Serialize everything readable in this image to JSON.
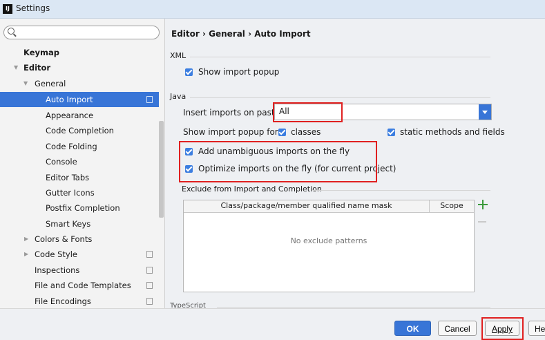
{
  "window": {
    "title": "Settings",
    "app_icon_text": "IJ"
  },
  "search": {
    "value": "",
    "placeholder": ""
  },
  "sidebar": {
    "items": [
      {
        "label": "Keymap"
      },
      {
        "label": "Editor"
      },
      {
        "label": "General"
      },
      {
        "label": "Auto Import"
      },
      {
        "label": "Appearance"
      },
      {
        "label": "Code Completion"
      },
      {
        "label": "Code Folding"
      },
      {
        "label": "Console"
      },
      {
        "label": "Editor Tabs"
      },
      {
        "label": "Gutter Icons"
      },
      {
        "label": "Postfix Completion"
      },
      {
        "label": "Smart Keys"
      },
      {
        "label": "Colors & Fonts"
      },
      {
        "label": "Code Style"
      },
      {
        "label": "Inspections"
      },
      {
        "label": "File and Code Templates"
      },
      {
        "label": "File Encodings"
      }
    ]
  },
  "main": {
    "breadcrumb": "Editor › General › Auto Import",
    "xml": {
      "section_title": "XML",
      "show_import_popup": {
        "label": "Show import popup",
        "checked": true
      }
    },
    "java": {
      "section_title": "Java",
      "insert_imports_label": "Insert imports on paste:",
      "insert_imports_value": "All",
      "show_popup_for_label": "Show import popup for:",
      "classes_label": "classes",
      "static_label": "static methods and fields",
      "add_unambiguous_label": "Add unambiguous imports on the fly",
      "optimize_label": "Optimize imports on the fly (for current project)"
    },
    "exclude": {
      "section_title": "Exclude from Import and Completion",
      "columns": [
        "Class/package/member qualified name mask",
        "Scope"
      ],
      "empty_text": "No exclude patterns"
    },
    "next_section_partial": "TypeScript"
  },
  "footer": {
    "ok": "OK",
    "cancel": "Cancel",
    "apply": "Apply",
    "help": "Help"
  },
  "colors": {
    "selection": "#3875d7",
    "highlight": "#e02020",
    "checkbox": "#3c7ee0"
  }
}
